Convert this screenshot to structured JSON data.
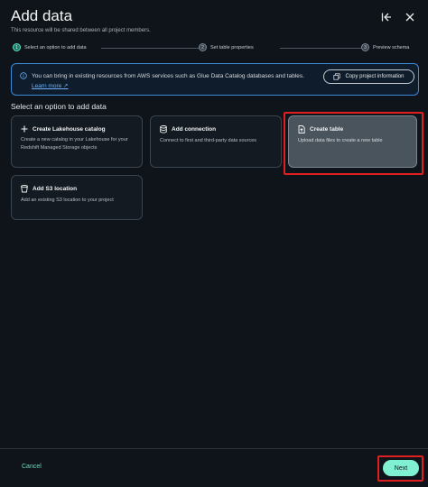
{
  "header": {
    "title": "Add data",
    "subtitle": "This resource will be shared between all project members."
  },
  "steps": [
    {
      "number": "1",
      "label": "Select an option to add data"
    },
    {
      "number": "2",
      "label": "Set table properties"
    },
    {
      "number": "3",
      "label": "Preview schema"
    }
  ],
  "info": {
    "text": "You can bring in existing resources from AWS services such as Glue Data Catalog databases and tables.",
    "link": "Learn more",
    "copy_button": "Copy project information"
  },
  "section_title": "Select an option to add data",
  "options": [
    {
      "title": "Create Lakehouse catalog",
      "description": "Create a new catalog in your Lakehouse for your Redshift Managed Storage objects",
      "icon": "plus-icon"
    },
    {
      "title": "Add connection",
      "description": "Connect to first and third-party data sources",
      "icon": "database-icon"
    },
    {
      "title": "Create table",
      "description": "Upload data files to create a new table",
      "icon": "file-upload-icon",
      "selected": true
    },
    {
      "title": "Add S3 location",
      "description": "Add an existing S3 location to your project",
      "icon": "bucket-icon"
    }
  ],
  "footer": {
    "cancel": "Cancel",
    "next": "Next"
  },
  "colors": {
    "accent": "#7ff0d2",
    "info_border": "#3e8ad9",
    "highlight": "#e02020"
  }
}
